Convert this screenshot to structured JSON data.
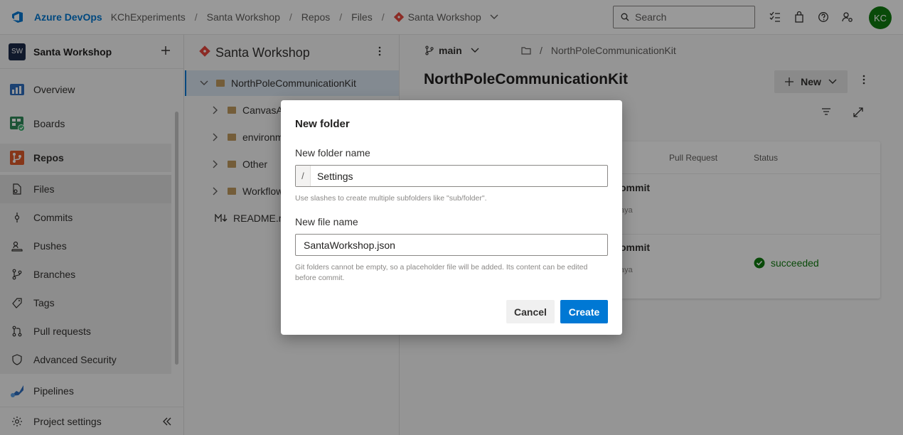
{
  "topbar": {
    "brand": "Azure DevOps",
    "breadcrumb": [
      "KChExperiments",
      "Santa Workshop",
      "Repos",
      "Files"
    ],
    "repo": "Santa Workshop",
    "search_placeholder": "Search",
    "avatar_initials": "KC"
  },
  "project": {
    "badge": "SW",
    "name": "Santa Workshop"
  },
  "nav": {
    "overview": "Overview",
    "boards": "Boards",
    "repos": "Repos",
    "files": "Files",
    "commits": "Commits",
    "pushes": "Pushes",
    "branches": "Branches",
    "tags": "Tags",
    "pull_requests": "Pull requests",
    "advanced_security": "Advanced Security",
    "pipelines": "Pipelines",
    "project_settings": "Project settings"
  },
  "tree": {
    "title": "Santa Workshop",
    "items": [
      {
        "label": "NorthPoleCommunicationKit"
      },
      {
        "label": "CanvasApps"
      },
      {
        "label": "environment"
      },
      {
        "label": "Other"
      },
      {
        "label": "Workflows"
      },
      {
        "label": "README.md"
      }
    ]
  },
  "main": {
    "branch": "main",
    "path": "NorthPoleCommunicationKit",
    "title": "NorthPoleCommunicationKit",
    "new_label": "New",
    "columns": {
      "pull_request": "Pull Request",
      "status": "Status"
    },
    "rows": [
      {
        "commit": "ommit",
        "author": "aya"
      },
      {
        "commit": "ommit",
        "author": "aya",
        "status": "succeeded"
      }
    ]
  },
  "dialog": {
    "title": "New folder",
    "folder_label": "New folder name",
    "folder_prefix": "/",
    "folder_value": "Settings",
    "folder_hint": "Use slashes to create multiple subfolders like \"sub/folder\".",
    "file_label": "New file name",
    "file_value": "SantaWorkshop.json",
    "file_hint": "Git folders cannot be empty, so a placeholder file will be added. Its content can be edited before commit.",
    "cancel": "Cancel",
    "create": "Create"
  },
  "colors": {
    "accent": "#0078d4",
    "success": "#107c10",
    "git": "#e8483e"
  }
}
